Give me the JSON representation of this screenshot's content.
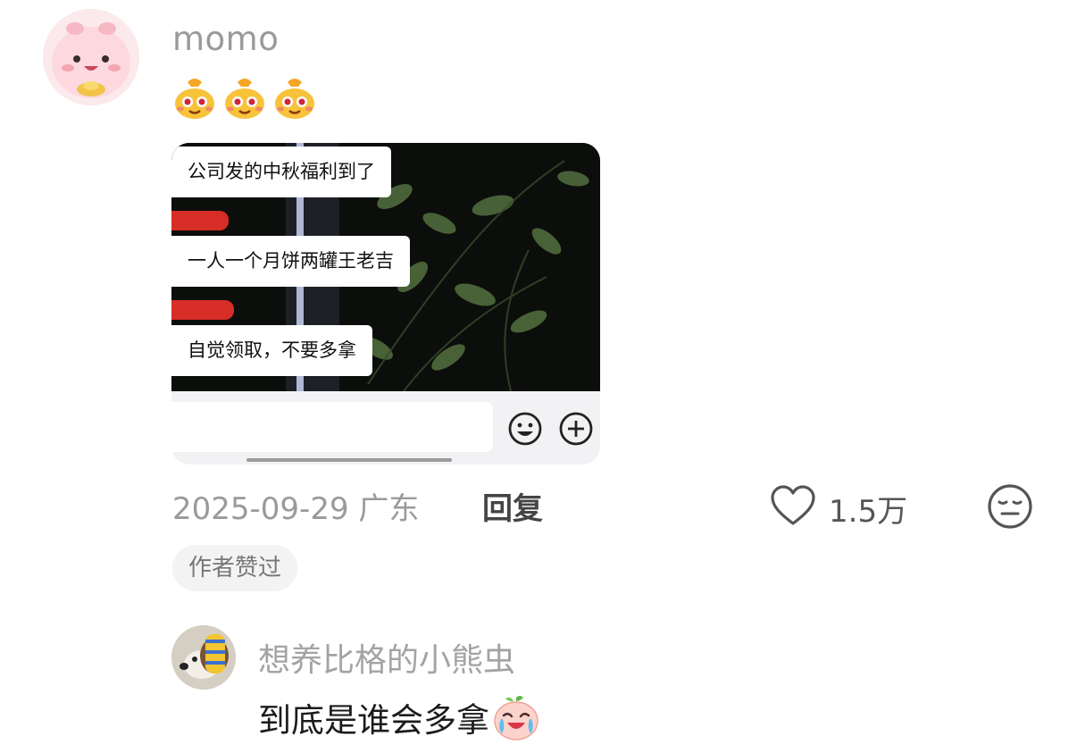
{
  "comment": {
    "username": "momo",
    "avatar_icon": "pink-character-avatar",
    "emojis": [
      "money-bag-emoji",
      "money-bag-emoji",
      "money-bag-emoji"
    ],
    "image": {
      "captions": [
        "公司发的中秋福利到了",
        "一人一个月饼两罐王老吉",
        "自觉领取，不要多拿"
      ],
      "icons": [
        "smiley-face-icon",
        "plus-circle-icon"
      ]
    },
    "date": "2025-09-29 广东",
    "reply_label": "回复",
    "like_count": "1.5万",
    "author_badge": "作者赞过"
  },
  "reply": {
    "username": "想养比格的小熊虫",
    "text": "到底是谁会多拿",
    "emoji": "crying-laughing-peach-emoji",
    "avatar_icon": "beagle-dog-avatar"
  },
  "colors": {
    "meta_gray": "#9a9a9a",
    "redaction_red": "#e8302a",
    "badge_bg": "#f3f3f3"
  }
}
